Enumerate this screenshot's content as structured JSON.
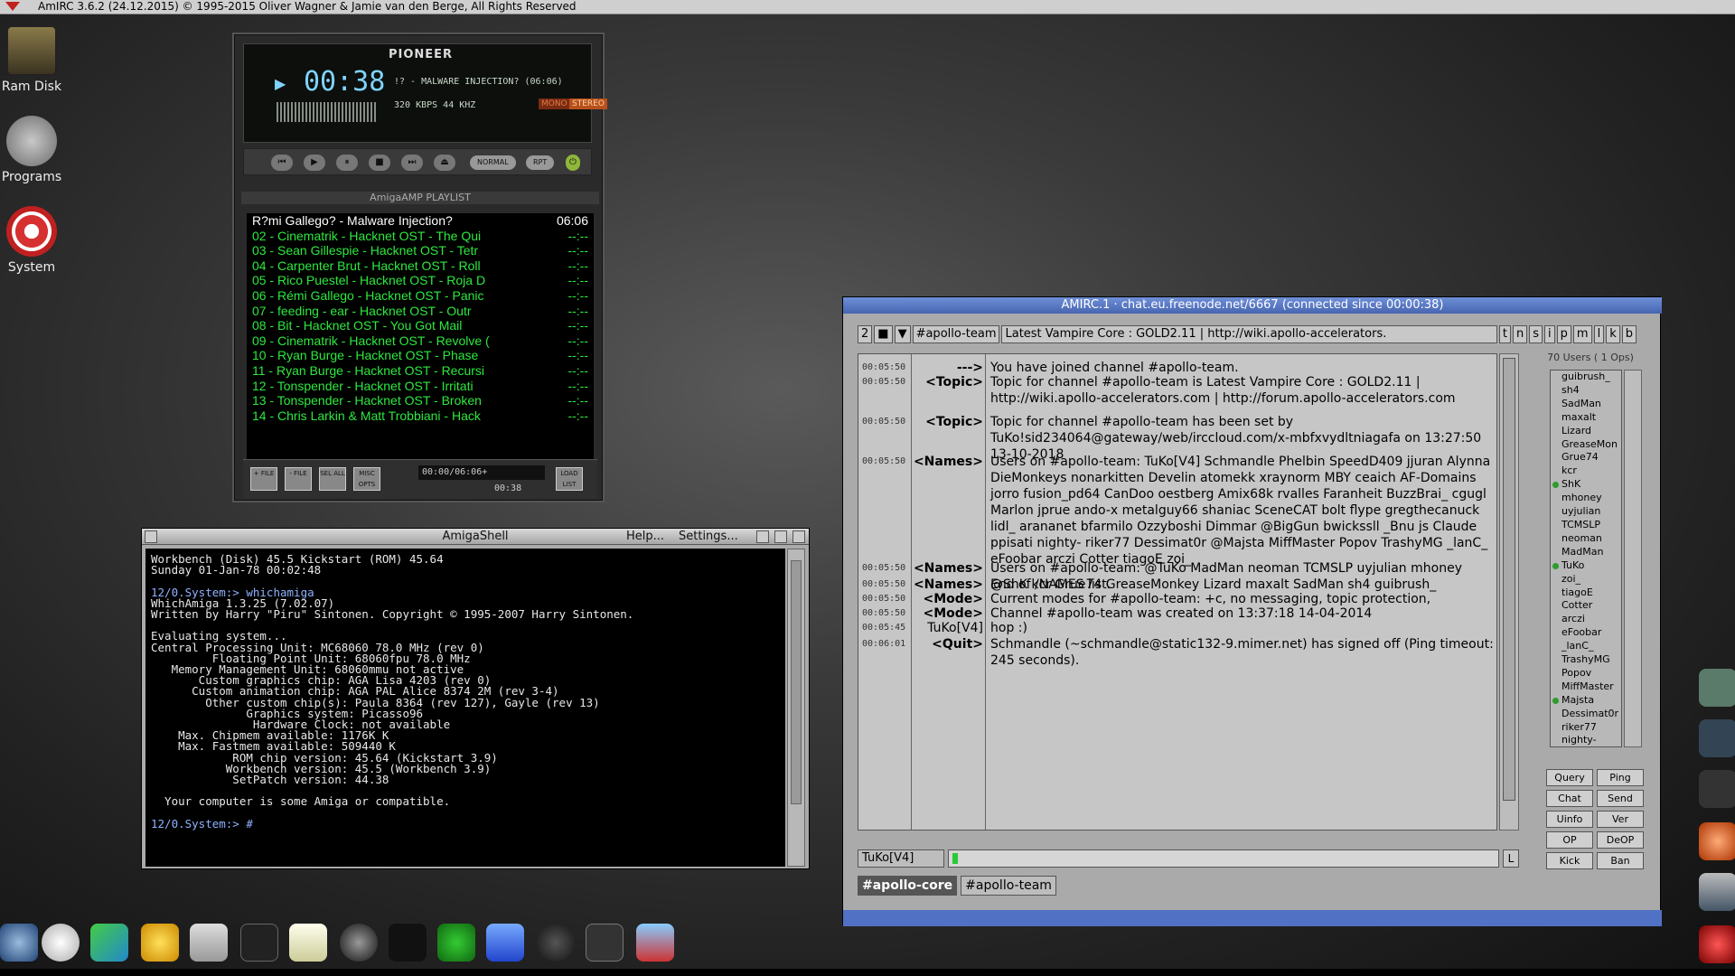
{
  "screen_title": "AmIRC 3.6.2 (24.12.2015) © 1995-2015 Oliver Wagner & Jamie van den Berge, All Rights Reserved",
  "desktop_icons": [
    {
      "name": "ram-disk-icon",
      "label": "Ram Disk"
    },
    {
      "name": "programs-icon",
      "label": "Programs"
    },
    {
      "name": "system-icon",
      "label": "System"
    }
  ],
  "player": {
    "brand": "PIONEER",
    "time": "00:38",
    "song": "!? - MALWARE INJECTION? (06:06)",
    "kbps": "320 KBPS  44 KHZ",
    "mono": "MONO",
    "stereo": "STEREO",
    "mode_normal": "NORMAL",
    "mode_rpt": "RPT",
    "playlist_title": "AmigaAMP PLAYLIST",
    "playlist": [
      {
        "title": "R?mi Gallego? - Malware Injection?",
        "dur": "06:06"
      },
      {
        "title": "02 - Cinematrik - Hacknet OST - The Qui",
        "dur": "--:--"
      },
      {
        "title": "03 - Sean Gillespie - Hacknet OST - Tetr",
        "dur": "--:--"
      },
      {
        "title": "04 - Carpenter Brut - Hacknet OST - Roll",
        "dur": "--:--"
      },
      {
        "title": "05 - Rico Puestel - Hacknet OST - Roja D",
        "dur": "--:--"
      },
      {
        "title": "06 - Rémi Gallego - Hacknet OST - Panic",
        "dur": "--:--"
      },
      {
        "title": "07 - feeding - ear - Hacknet OST - Outr",
        "dur": "--:--"
      },
      {
        "title": "08 - Bit - Hacknet OST - You Got Mail",
        "dur": "--:--"
      },
      {
        "title": "09 - Cinematrik - Hacknet OST - Revolve (",
        "dur": "--:--"
      },
      {
        "title": "10 - Ryan Burge - Hacknet OST - Phase",
        "dur": "--:--"
      },
      {
        "title": "11 - Ryan Burge - Hacknet OST - Recursi",
        "dur": "--:--"
      },
      {
        "title": "12 - Tonspender - Hacknet OST - Irritati",
        "dur": "--:--"
      },
      {
        "title": "13 - Tonspender - Hacknet OST - Broken",
        "dur": "--:--"
      },
      {
        "title": "14 - Chris Larkin & Matt Trobbiani - Hack",
        "dur": "--:--"
      }
    ],
    "pl_btns": [
      "+ FILE",
      "- FILE",
      "SEL ALL",
      "MISC OPTS",
      "LOAD LIST"
    ],
    "pl_time": "00:00/06:06+",
    "pl_time2": "00:38"
  },
  "shell": {
    "title": "AmigaShell",
    "help": "Help...",
    "settings": "Settings...",
    "lines": [
      "Workbench (Disk) 45.5 Kickstart (ROM) 45.64",
      "Sunday 01-Jan-78 00:02:48",
      "",
      "12/0.System:> whichamiga",
      "WhichAmiga 1.3.25 (7.02.07)",
      "Written by Harry \"Piru\" Sintonen. Copyright © 1995-2007 Harry Sintonen.",
      "",
      "Evaluating system...",
      "Central Processing Unit: MC68060 78.0 MHz (rev 0)",
      "         Floating Point Unit: 68060fpu 78.0 MHz",
      "   Memory Management Unit: 68060mmu not active",
      "       Custom graphics chip: AGA Lisa 4203 (rev 0)",
      "      Custom animation chip: AGA PAL Alice 8374 2M (rev 3-4)",
      "        Other custom chip(s): Paula 8364 (rev 127), Gayle (rev 13)",
      "              Graphics system: Picasso96",
      "               Hardware Clock: not available",
      "    Max. Chipmem available: 1176K K",
      "    Max. Fastmem available: 509440 K",
      "            ROM chip version: 45.64 (Kickstart 3.9)",
      "           Workbench version: 45.5 (Workbench 3.9)",
      "            SetPatch version: 44.38",
      "",
      "  Your computer is some Amiga or compatible.",
      "",
      "12/0.System:> #"
    ]
  },
  "irc": {
    "title": "AMIRC.1 · chat.eu.freenode.net/6667 (connected since 00:00:38)",
    "num": "2",
    "channel_btn": "#apollo-team",
    "topic": "Latest Vampire Core : GOLD2.11 | http://wiki.apollo-accelerators.",
    "mode_btns": [
      "t",
      "n",
      "s",
      "i",
      "p",
      "m",
      "l",
      "k",
      "b"
    ],
    "users_header": "70 Users ( 1 Ops)",
    "log": [
      {
        "ts": "00:05:50",
        "nick": "--->",
        "text": "You have joined channel #apollo-team."
      },
      {
        "ts": "00:05:50",
        "nick": "<Topic>",
        "text": "Topic for channel #apollo-team is Latest Vampire Core : GOLD2.11 | http://wiki.apollo-accelerators.com | http://forum.apollo-accelerators.com"
      },
      {
        "ts": "00:05:50",
        "nick": "<Topic>",
        "text": "Topic for channel #apollo-team has been set by TuKo!sid234064@gateway/web/irccloud.com/x-mbfxvydltniagafa on 13:27:50 13-10-2018"
      },
      {
        "ts": "00:05:50",
        "nick": "<Names>",
        "text": "Users on #apollo-team: TuKo[V4] Schmandle Phelbin SpeedD409 jjuran Alynna DieMonkeys nonarkitten Develin atomekk xraynorm MBY ceaich AF-Domains jorro fusion_pd64 CanDoo oestberg Amix68k rvalles Faranheit BuzzBrai_ cgugl Marlon jprue ando-x metalguy66 shaniac SceneCAT bolt flype gregthecanuck lidl_ arananet bfarmilo Ozzyboshi Dimmar @BigGun bwickssll _Bnu js Claude ppisati nighty- riker77 Dessimat0r @Majsta MiffMaster Popov TrashyMG _lanC_ eFoobar arczi Cotter tiagoE zoi_"
      },
      {
        "ts": "00:05:50",
        "nick": "<Names>",
        "text": "Users on #apollo-team: @TuKo MadMan neoman TCMSLP uyjulian mhoney @ShK kcr Grue74 GreaseMonkey Lizard maxalt SadMan sh4 guibrush_"
      },
      {
        "ts": "00:05:50",
        "nick": "<Names>",
        "text": "End of /NAMES list."
      },
      {
        "ts": "00:05:50",
        "nick": "<Mode>",
        "text": "Current modes for #apollo-team: +c, no messaging, topic protection,"
      },
      {
        "ts": "00:05:50",
        "nick": "<Mode>",
        "text": "Channel #apollo-team was created on 13:37:18 14-04-2014"
      },
      {
        "ts": "00:05:45",
        "nick": "TuKo[V4]",
        "text": "hop :)"
      },
      {
        "ts": "00:06:01",
        "nick": "<Quit>",
        "text": "Schmandle (~schmandle@static132-9.mimer.net) has signed off (Ping timeout: 245 seconds)."
      }
    ],
    "users": [
      {
        "n": "guibrush_",
        "op": false
      },
      {
        "n": "sh4",
        "op": false
      },
      {
        "n": "SadMan",
        "op": false
      },
      {
        "n": "maxalt",
        "op": false
      },
      {
        "n": "Lizard",
        "op": false
      },
      {
        "n": "GreaseMon",
        "op": false
      },
      {
        "n": "Grue74",
        "op": false
      },
      {
        "n": "kcr",
        "op": false
      },
      {
        "n": "ShK",
        "op": true
      },
      {
        "n": "mhoney",
        "op": false
      },
      {
        "n": "uyjulian",
        "op": false
      },
      {
        "n": "TCMSLP",
        "op": false
      },
      {
        "n": "neoman",
        "op": false
      },
      {
        "n": "MadMan",
        "op": false
      },
      {
        "n": "TuKo",
        "op": true
      },
      {
        "n": "zoi_",
        "op": false
      },
      {
        "n": "tiagoE",
        "op": false
      },
      {
        "n": "Cotter",
        "op": false
      },
      {
        "n": "arczi",
        "op": false
      },
      {
        "n": "eFoobar",
        "op": false
      },
      {
        "n": "_lanC_",
        "op": false
      },
      {
        "n": "TrashyMG",
        "op": false
      },
      {
        "n": "Popov",
        "op": false
      },
      {
        "n": "MiffMaster",
        "op": false
      },
      {
        "n": "Majsta",
        "op": true
      },
      {
        "n": "Dessimat0r",
        "op": false
      },
      {
        "n": "riker77",
        "op": false
      },
      {
        "n": "nighty-",
        "op": false
      }
    ],
    "user_btns": [
      "Query",
      "Ping",
      "Chat",
      "Send",
      "Uinfo",
      "Ver",
      "OP",
      "DeOP",
      "Kick",
      "Ban"
    ],
    "nick": "TuKo[V4]",
    "lbtn": "L",
    "tabs": [
      "#apollo-core",
      "#apollo-team"
    ],
    "active_tab": 0
  },
  "colors": {
    "playlist_green": "#2de83e",
    "irc_title": "#5171c4",
    "prompt_blue": "#8fb2ff"
  }
}
